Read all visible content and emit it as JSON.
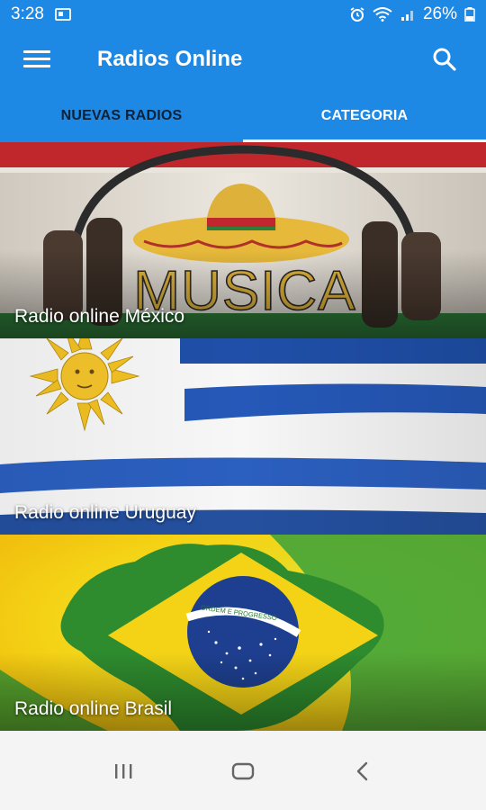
{
  "status_bar": {
    "time": "3:28",
    "battery": "26%",
    "icons": [
      "screen-cast-icon",
      "alarm-icon",
      "wifi-icon",
      "signal-icon",
      "battery-icon"
    ]
  },
  "app_bar": {
    "title": "Radios Online",
    "color": "#1e88e5",
    "icons": [
      "menu-icon",
      "search-icon"
    ]
  },
  "tabs": [
    {
      "label": "NUEVAS RADIOS",
      "active": false
    },
    {
      "label": "CATEGORIA",
      "active": true
    }
  ],
  "categories": [
    {
      "label": "Radio online México",
      "banner_text": "MUSICA"
    },
    {
      "label": "Radio online Uruguay"
    },
    {
      "label": "Radio online Brasil",
      "banner_text": "ORDEM E PROGRESSO"
    }
  ],
  "nav_bar": {
    "icons": [
      "recent-apps-icon",
      "home-icon",
      "back-icon"
    ]
  }
}
